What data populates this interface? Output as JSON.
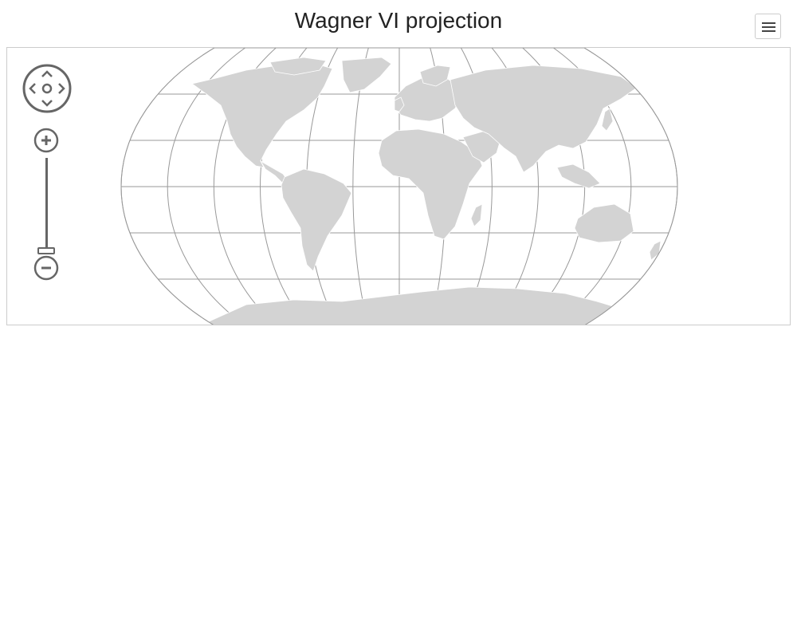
{
  "title": "Wagner VI projection",
  "header": {
    "menu_icon": "hamburger-menu-icon"
  },
  "map": {
    "projection": "Wagner VI",
    "graticule": true,
    "land_color": "#d3d3d3",
    "border_color": "#ffffff",
    "graticule_color": "#999999",
    "outline_color": "#999999"
  },
  "controls": {
    "pan_icon": "pan-navigation-icon",
    "zoom_in_icon": "zoom-in-icon",
    "zoom_out_icon": "zoom-out-icon",
    "zoom_level": 0
  }
}
